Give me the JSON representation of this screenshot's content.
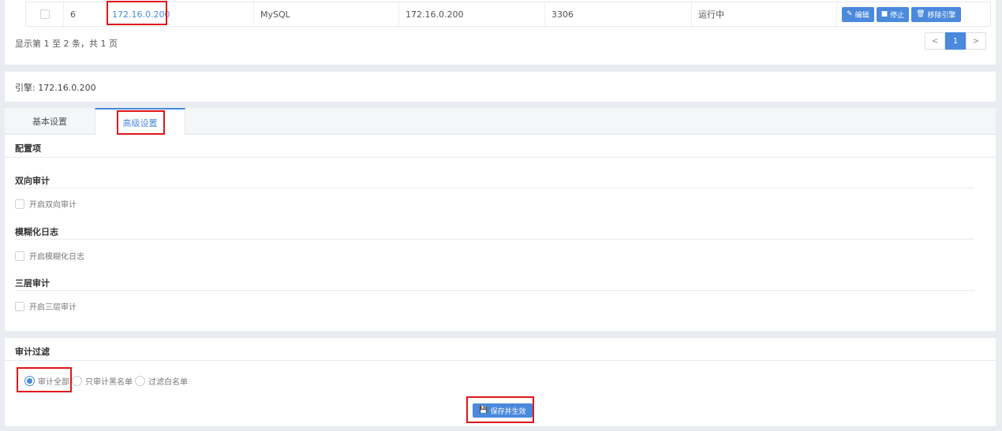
{
  "table": {
    "row": {
      "index": "6",
      "name": "172.16.0.200",
      "db_type": "MySQL",
      "host": "172.16.0.200",
      "port": "3306",
      "status": "运行中",
      "actions": {
        "edit": "编辑",
        "stop": "停止",
        "remove": "移除引擎"
      }
    },
    "summary": "显示第 1 至 2 条，共 1 页",
    "pager": {
      "prev": "<",
      "current": "1",
      "next": ">"
    }
  },
  "engine": {
    "label": "引擎: 172.16.0.200"
  },
  "tabs": [
    {
      "label": "基本设置",
      "active": false
    },
    {
      "label": "高级设置",
      "active": true
    }
  ],
  "config": {
    "title": "配置项",
    "sections": [
      {
        "heading": "双向审计",
        "option": "开启双向审计",
        "checked": false
      },
      {
        "heading": "模糊化日志",
        "option": "开启模糊化日志",
        "checked": false
      },
      {
        "heading": "三层审计",
        "option": "开启三层审计",
        "checked": false
      }
    ]
  },
  "filter": {
    "title": "审计过滤",
    "options": [
      {
        "label": "审计全部",
        "selected": true
      },
      {
        "label": "只审计黑名单",
        "selected": false
      },
      {
        "label": "过滤白名单",
        "selected": false
      }
    ],
    "save_label": "保存并生效"
  },
  "colors": {
    "accent": "#4a89dc",
    "highlight": "#e0151b"
  },
  "icons": {
    "edit": "edit-icon",
    "stop": "stop-icon",
    "remove": "trash-icon",
    "save": "floppy-icon"
  }
}
